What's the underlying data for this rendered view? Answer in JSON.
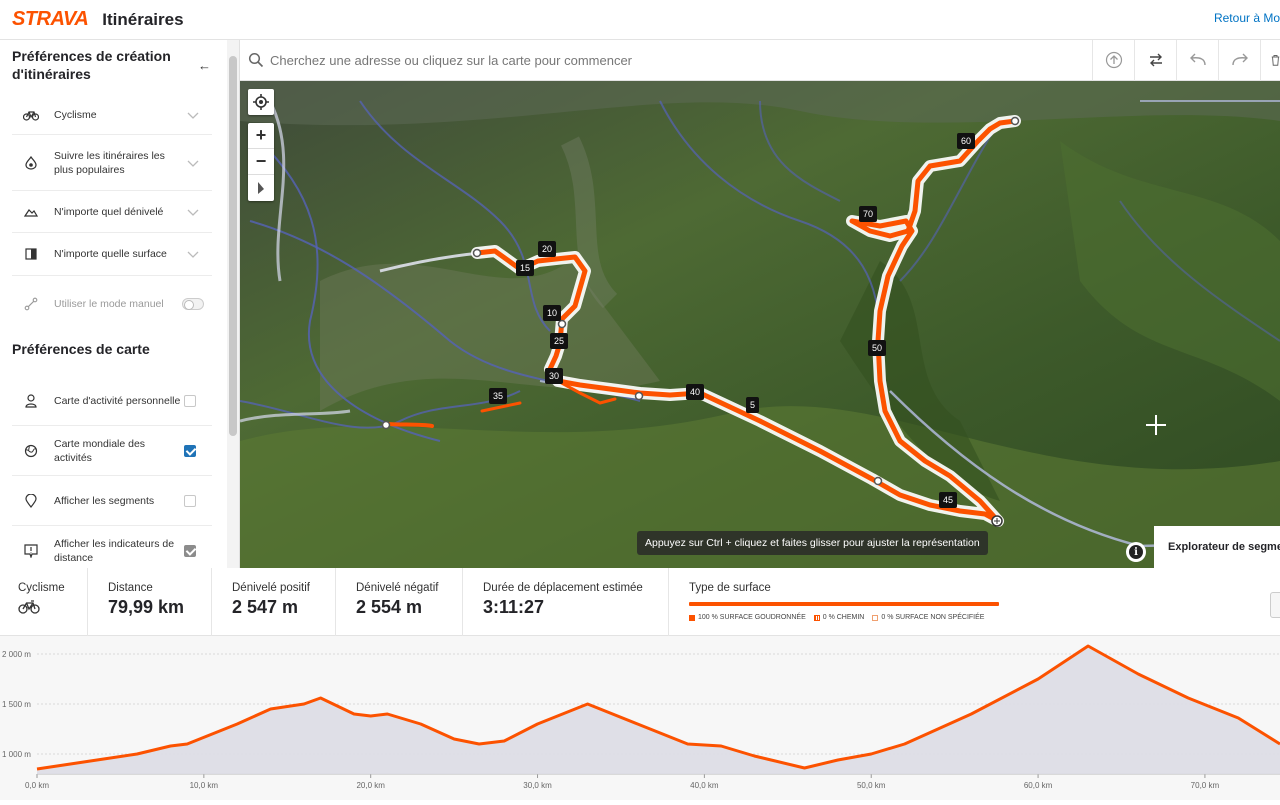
{
  "header": {
    "logo": "STRAVA",
    "title": "Itinéraires",
    "back_link": "Retour à Mo"
  },
  "sidebar": {
    "route_prefs_title": "Préférences de création d'itinéraires",
    "route_prefs": [
      {
        "icon": "bike-icon",
        "label": "Cyclisme"
      },
      {
        "icon": "heatmap-icon",
        "label": "Suivre les itinéraires les plus populaires"
      },
      {
        "icon": "elevation-icon",
        "label": "N'importe quel dénivelé"
      },
      {
        "icon": "surface-icon",
        "label": "N'importe quelle surface"
      }
    ],
    "manual_mode_label": "Utiliser le mode manuel",
    "manual_mode_on": false,
    "map_prefs_title": "Préférences de carte",
    "map_prefs": [
      {
        "icon": "person-icon",
        "label": "Carte d'activité personnelle",
        "checked": false
      },
      {
        "icon": "globe-icon",
        "label": "Carte mondiale des activités",
        "checked": true
      },
      {
        "icon": "segment-pin-icon",
        "label": "Afficher les segments",
        "checked": false
      },
      {
        "icon": "distance-marker-icon",
        "label": "Afficher les indicateurs de distance",
        "checked": true
      }
    ]
  },
  "search": {
    "placeholder": "Cherchez une adresse ou cliquez sur la carte pour commencer"
  },
  "map": {
    "hint": "Appuyez sur Ctrl + cliquez et faites glisser pour ajuster la représentation",
    "segment_explorer": "Explorateur de segments",
    "km_markers": [
      "60",
      "70",
      "20",
      "15",
      "10",
      "25",
      "50",
      "30",
      "40",
      "5",
      "35",
      "45"
    ]
  },
  "stats": {
    "sport_label": "Cyclisme",
    "distance_label": "Distance",
    "distance": "79,99 km",
    "gain_label": "Dénivelé positif",
    "gain": "2 547 m",
    "loss_label": "Dénivelé négatif",
    "loss": "2 554 m",
    "duration_label": "Durée de déplacement estimée",
    "duration": "3:11:27",
    "surface_label": "Type de surface",
    "surface_legend": [
      "100 % SURFACE GOUDRONNÉE",
      "0 % CHEMIN",
      "0 % SURFACE NON SPÉCIFIÉE"
    ],
    "paved_fraction": 1.0
  },
  "chart_data": {
    "type": "area",
    "xlabel": "",
    "ylabel": "",
    "x_tick_labels": [
      "0,0 km",
      "10,0 km",
      "20,0 km",
      "30,0 km",
      "40,0 km",
      "50,0 km",
      "60,0 km",
      "70,0 km"
    ],
    "y_tick_labels": [
      "1 000 m",
      "1 500 m",
      "2 000 m"
    ],
    "xlim": [
      0,
      74.5
    ],
    "ylim": [
      800,
      2100
    ],
    "series": [
      {
        "x": [
          0,
          2,
          4,
          6,
          8,
          9,
          12,
          14,
          16,
          17,
          19,
          20,
          21,
          23,
          25,
          26.5,
          28,
          30,
          33,
          36,
          39,
          41,
          43,
          44,
          46,
          48,
          50,
          52,
          56,
          60,
          63,
          66,
          69,
          72,
          74.5
        ],
        "y": [
          850,
          900,
          950,
          1000,
          1080,
          1100,
          1300,
          1450,
          1500,
          1560,
          1400,
          1380,
          1400,
          1300,
          1150,
          1100,
          1130,
          1300,
          1500,
          1300,
          1100,
          1080,
          980,
          940,
          860,
          940,
          1000,
          1100,
          1400,
          1750,
          2080,
          1800,
          1560,
          1360,
          1100
        ],
        "color": "#fc5200"
      }
    ]
  }
}
